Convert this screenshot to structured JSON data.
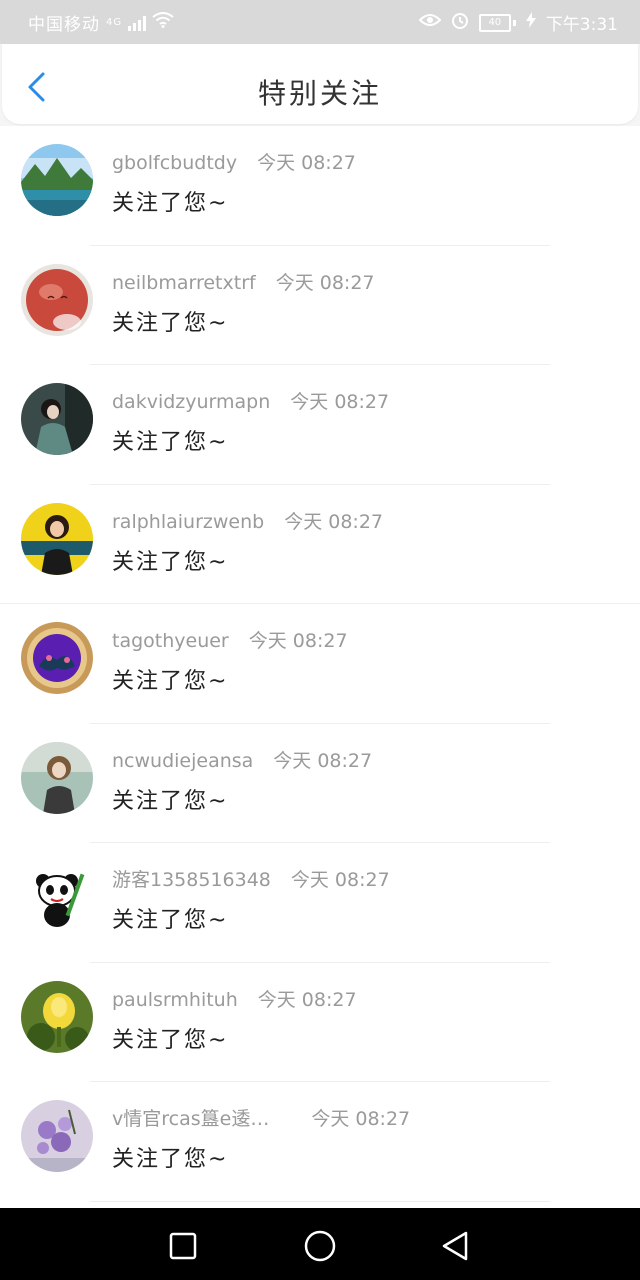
{
  "status": {
    "carrier": "中国移动",
    "network": "4G",
    "battery": "40",
    "time": "下午3:31"
  },
  "header": {
    "title": "特别关注"
  },
  "items": [
    {
      "username": "gbolfcbudtdy",
      "time": "今天 08:27",
      "message": "关注了您~"
    },
    {
      "username": "neilbmarretxtrf",
      "time": "今天 08:27",
      "message": "关注了您~"
    },
    {
      "username": "dakvidzyurmapn",
      "time": "今天 08:27",
      "message": "关注了您~"
    },
    {
      "username": "ralphlaiurzwenb",
      "time": "今天 08:27",
      "message": "关注了您~"
    },
    {
      "username": "tagothyeuer",
      "time": "今天 08:27",
      "message": "关注了您~"
    },
    {
      "username": "ncwudiejeansa",
      "time": "今天 08:27",
      "message": "关注了您~"
    },
    {
      "username": "游客1358516348",
      "time": "今天 08:27",
      "message": "关注了您~"
    },
    {
      "username": "paulsrmhituh",
      "time": "今天 08:27",
      "message": "关注了您~"
    },
    {
      "username": "v情官rcas簋e逶…",
      "time": "今天 08:27",
      "message": "关注了您~"
    }
  ],
  "colors": {
    "accent": "#2b8ce8",
    "status_bar": "#d9d9d9"
  }
}
